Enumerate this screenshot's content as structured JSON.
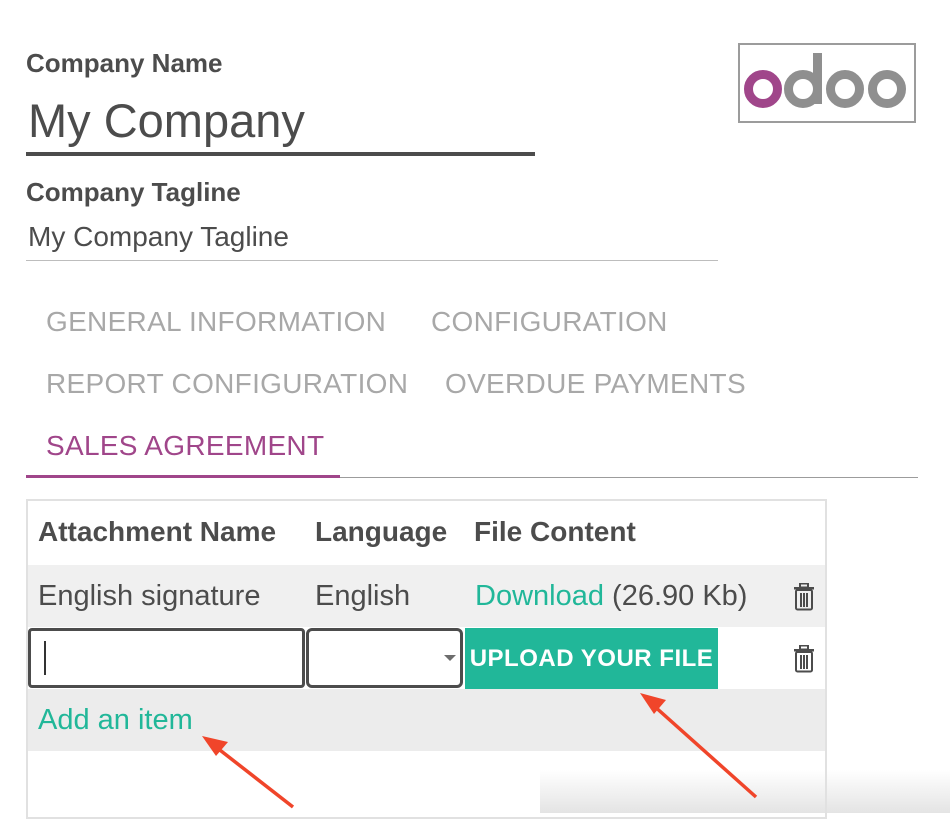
{
  "company": {
    "name_label": "Company Name",
    "name_value": "My Company",
    "tagline_label": "Company Tagline",
    "tagline_value": "My Company Tagline",
    "logo_text": "odoo"
  },
  "tabs": [
    {
      "label": "GENERAL INFORMATION",
      "active": false
    },
    {
      "label": "CONFIGURATION",
      "active": false
    },
    {
      "label": "REPORT CONFIGURATION",
      "active": false
    },
    {
      "label": "OVERDUE PAYMENTS",
      "active": false
    },
    {
      "label": "SALES AGREEMENT",
      "active": true
    }
  ],
  "table": {
    "columns": [
      "Attachment Name",
      "Language",
      "File Content"
    ],
    "rows": [
      {
        "attachment_name": "English signature",
        "language": "English",
        "download_label": "Download",
        "size": "(26.90 Kb)"
      }
    ],
    "edit_row": {
      "name_value": "",
      "language_value": "",
      "upload_label": "UPLOAD YOUR FILE"
    },
    "add_item_label": "Add an item"
  },
  "colors": {
    "accent_purple": "#a0468a",
    "accent_teal": "#21b799",
    "arrow_red": "#f0452a",
    "text_dark": "#4c4c4c",
    "tab_inactive": "#a8a8a8"
  },
  "icons": {
    "delete": "trash-icon",
    "annotation": "red-arrow-icon"
  }
}
